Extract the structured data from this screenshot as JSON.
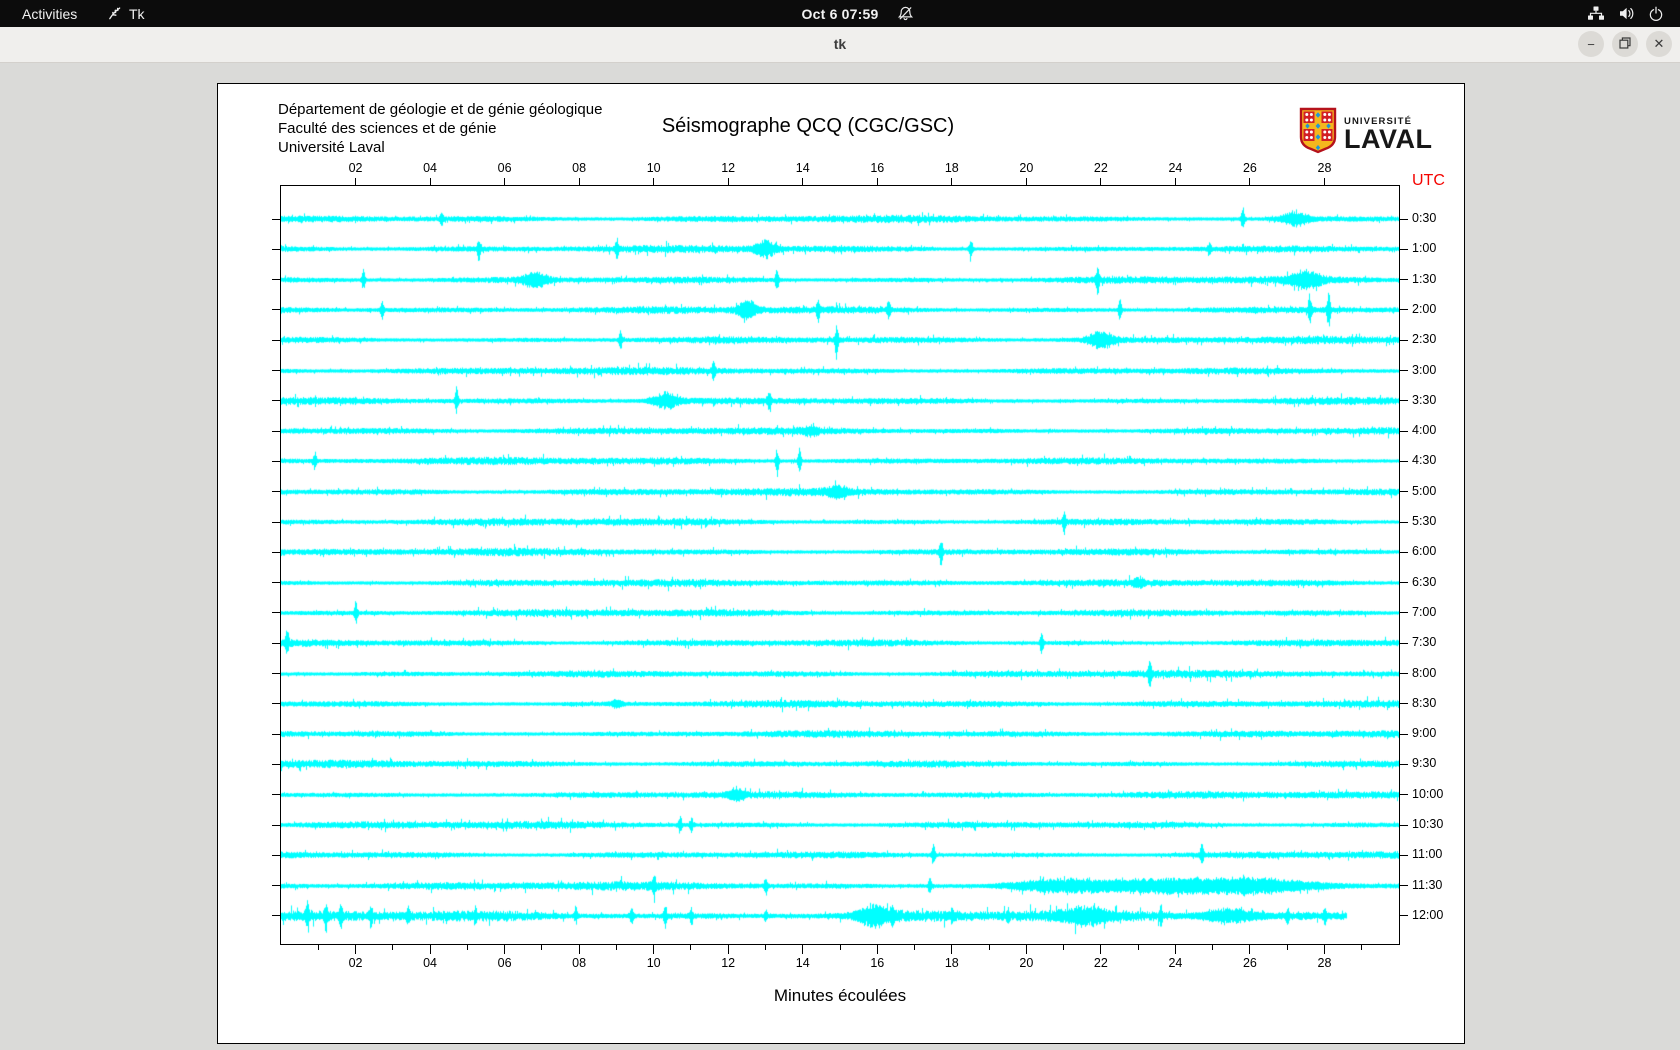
{
  "topbar": {
    "activities": "Activities",
    "app_name": "Tk",
    "clock": "Oct 6 07:59"
  },
  "titlebar": {
    "title": "tk",
    "minimize_label": "−",
    "close_label": "✕"
  },
  "seismograph": {
    "header_lines": [
      "Département de géologie et de génie géologique",
      "Faculté des sciences et de génie",
      "Université Laval"
    ],
    "title": "Séismographe QCQ (CGC/GSC)",
    "logo": {
      "line1": "UNIVERSITÉ",
      "line2": "LAVAL"
    },
    "utc_label": "UTC",
    "x_axis_label": "Minutes écoulées",
    "x_minutes_max": 30,
    "x_ticks": [
      [
        2,
        "02"
      ],
      [
        4,
        "04"
      ],
      [
        6,
        "06"
      ],
      [
        8,
        "08"
      ],
      [
        10,
        "10"
      ],
      [
        12,
        "12"
      ],
      [
        14,
        "14"
      ],
      [
        16,
        "16"
      ],
      [
        18,
        "18"
      ],
      [
        20,
        "20"
      ],
      [
        22,
        "22"
      ],
      [
        24,
        "24"
      ],
      [
        26,
        "26"
      ],
      [
        28,
        "28"
      ]
    ],
    "rows": [
      "0:30",
      "1:00",
      "1:30",
      "2:00",
      "2:30",
      "3:00",
      "3:30",
      "4:00",
      "4:30",
      "5:00",
      "5:30",
      "6:00",
      "6:30",
      "7:00",
      "7:30",
      "8:00",
      "8:30",
      "9:00",
      "9:30",
      "10:00",
      "10:30",
      "11:00",
      "11:30",
      "12:00"
    ],
    "trace_color": "#00ffff",
    "utc_color": "#f40400",
    "noise_seed": 1337,
    "base_amp": 1.6,
    "row_amp_overrides": {
      "22": 2.0,
      "23": 3.0
    },
    "last_row_end_minute": 28.6,
    "events": [
      [
        [
          4.3,
          4
        ],
        [
          25.8,
          10
        ],
        [
          27.2,
          5,
          0.5
        ]
      ],
      [
        [
          5.3,
          9
        ],
        [
          9.0,
          8
        ],
        [
          13.0,
          6,
          0.4
        ],
        [
          18.5,
          10
        ],
        [
          24.9,
          4
        ]
      ],
      [
        [
          2.2,
          9
        ],
        [
          6.8,
          5,
          0.5
        ],
        [
          13.3,
          9
        ],
        [
          21.9,
          11
        ],
        [
          27.5,
          6,
          0.6
        ]
      ],
      [
        [
          2.7,
          8
        ],
        [
          12.5,
          7,
          0.35
        ],
        [
          14.4,
          9
        ],
        [
          16.3,
          8
        ],
        [
          22.5,
          9
        ],
        [
          27.6,
          13
        ],
        [
          28.1,
          15
        ]
      ],
      [
        [
          9.1,
          9
        ],
        [
          14.9,
          14
        ],
        [
          22.0,
          6,
          0.5
        ]
      ],
      [
        [
          11.6,
          8
        ]
      ],
      [
        [
          4.7,
          10
        ],
        [
          10.3,
          6,
          0.5
        ],
        [
          13.1,
          9
        ]
      ],
      [
        [
          14.2,
          3,
          0.3
        ]
      ],
      [
        [
          0.9,
          6
        ],
        [
          13.3,
          12
        ],
        [
          13.9,
          10
        ]
      ],
      [
        [
          14.9,
          4,
          0.4
        ]
      ],
      [
        [
          21.0,
          9
        ]
      ],
      [
        [
          17.7,
          10
        ]
      ],
      [
        [
          23.0,
          3,
          0.2
        ]
      ],
      [
        [
          2.0,
          9
        ]
      ],
      [
        [
          0.15,
          10
        ],
        [
          20.4,
          10
        ]
      ],
      [
        [
          23.3,
          11
        ]
      ],
      [
        [
          9.0,
          3,
          0.2
        ]
      ],
      [],
      [],
      [
        [
          12.2,
          4,
          0.3
        ]
      ],
      [
        [
          10.7,
          7
        ],
        [
          11.0,
          6
        ]
      ],
      [
        [
          17.5,
          10
        ],
        [
          24.7,
          9
        ]
      ],
      [
        [
          10.0,
          8
        ],
        [
          13.0,
          7
        ],
        [
          17.4,
          7
        ],
        [
          21.0,
          4,
          2.0
        ],
        [
          23.5,
          4,
          2.0
        ],
        [
          26.0,
          4,
          2.5
        ]
      ],
      [
        [
          0.7,
          10
        ],
        [
          1.2,
          12
        ],
        [
          1.6,
          8
        ],
        [
          2.4,
          8
        ],
        [
          3.4,
          6
        ],
        [
          5.2,
          5
        ],
        [
          7.9,
          6
        ],
        [
          9.4,
          7
        ],
        [
          10.3,
          8
        ],
        [
          11.0,
          6
        ],
        [
          13.0,
          4
        ],
        [
          15.9,
          7,
          0.6
        ],
        [
          16.4,
          6
        ],
        [
          18.0,
          4
        ],
        [
          19.5,
          4
        ],
        [
          21.6,
          5,
          0.8
        ],
        [
          23.6,
          8
        ],
        [
          25.4,
          5,
          1.0
        ],
        [
          27.0,
          5
        ],
        [
          28.0,
          6
        ]
      ]
    ]
  }
}
